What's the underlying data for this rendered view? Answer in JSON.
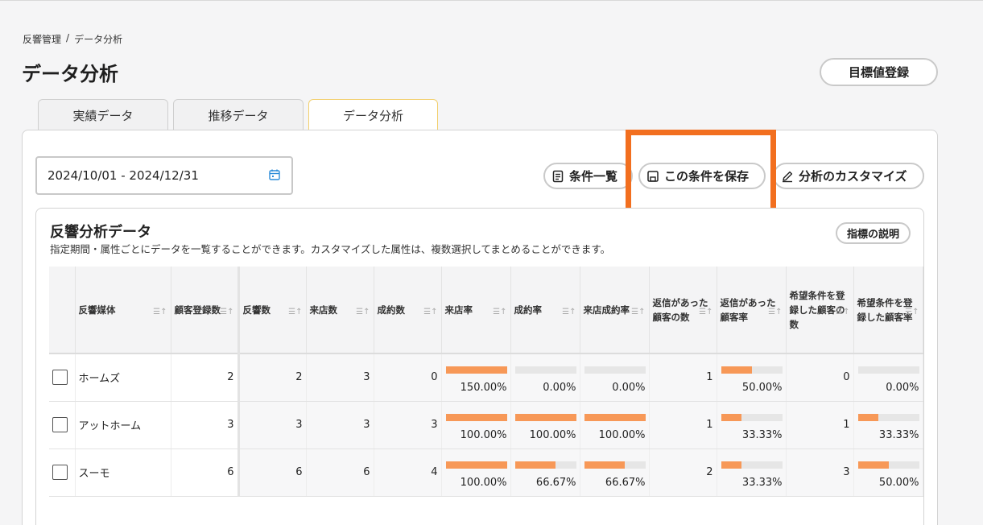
{
  "breadcrumb": {
    "parent": "反響管理",
    "separator": "/",
    "current": "データ分析"
  },
  "page_title": "データ分析",
  "goal_button": "目標値登録",
  "tabs": [
    "実績データ",
    "推移データ",
    "データ分析"
  ],
  "active_tab": "データ分析",
  "date_range": "2024/10/01 - 2024/12/31",
  "toolbar": {
    "list": "条件一覧",
    "save": "この条件を保存",
    "customize": "分析のカスタマイズ"
  },
  "highlight_color": "#f26f1f",
  "card": {
    "title": "反響分析データ",
    "description": "指定期間・属性ごとにデータを一覧することができます。カスタマイズした属性は、複数選択してまとめることができます。",
    "explain_button": "指標の説明"
  },
  "table": {
    "columns": [
      "反響媒体",
      "顧客登録数",
      "反響数",
      "来店数",
      "成約数",
      "来店率",
      "成約率",
      "来店成約率",
      "返信があった顧客の数",
      "返信があった顧客率",
      "希望条件を登録した顧客の数",
      "希望条件を登録した顧客率"
    ],
    "rows": [
      {
        "name": "ホームズ",
        "registered": "2",
        "responses": "2",
        "visits": "3",
        "contracts": "0",
        "visit_rate": "150.00%",
        "visit_rate_pct": 100,
        "contract_rate": "0.00%",
        "contract_rate_pct": 0,
        "visit_contract_rate": "0.00%",
        "visit_contract_rate_pct": 0,
        "replied": "1",
        "replied_rate": "50.00%",
        "replied_rate_pct": 50,
        "wished": "0",
        "wished_rate": "0.00%",
        "wished_rate_pct": 0
      },
      {
        "name": "アットホーム",
        "registered": "3",
        "responses": "3",
        "visits": "3",
        "contracts": "3",
        "visit_rate": "100.00%",
        "visit_rate_pct": 100,
        "contract_rate": "100.00%",
        "contract_rate_pct": 100,
        "visit_contract_rate": "100.00%",
        "visit_contract_rate_pct": 100,
        "replied": "1",
        "replied_rate": "33.33%",
        "replied_rate_pct": 33.33,
        "wished": "1",
        "wished_rate": "33.33%",
        "wished_rate_pct": 33.33
      },
      {
        "name": "スーモ",
        "registered": "6",
        "responses": "6",
        "visits": "6",
        "contracts": "4",
        "visit_rate": "100.00%",
        "visit_rate_pct": 100,
        "contract_rate": "66.67%",
        "contract_rate_pct": 66.67,
        "visit_contract_rate": "66.67%",
        "visit_contract_rate_pct": 66.67,
        "replied": "2",
        "replied_rate": "33.33%",
        "replied_rate_pct": 33.33,
        "wished": "3",
        "wished_rate": "50.00%",
        "wished_rate_pct": 50
      }
    ]
  }
}
